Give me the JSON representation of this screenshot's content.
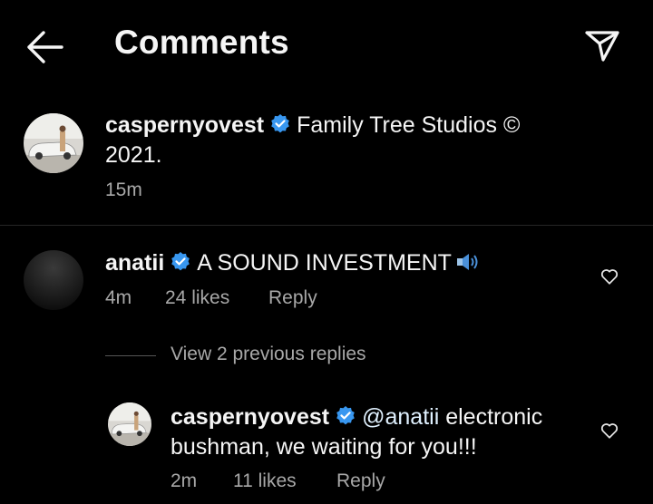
{
  "header": {
    "title": "Comments"
  },
  "caption": {
    "username": "caspernyovest",
    "text": "Family Tree Studios © 2021.",
    "time": "15m"
  },
  "comment": {
    "username": "anatii",
    "text": "A SOUND INVESTMENT",
    "time": "4m",
    "likes": "24 likes",
    "reply_label": "Reply",
    "view_replies": "View 2 previous replies"
  },
  "reply": {
    "username": "caspernyovest",
    "mention": "@anatii",
    "text": " electronic bushman, we waiting for you!!!",
    "time": "2m",
    "likes": "11 likes",
    "reply_label": "Reply"
  },
  "colors": {
    "background": "#000000",
    "text": "#f5f5f5",
    "secondary": "#a8a8a8",
    "verified": "#3897f0"
  },
  "icons": {
    "back": "arrow-left-icon",
    "send": "paper-plane-icon",
    "verified": "verified-badge-icon",
    "heart": "heart-outline-icon",
    "speaker": "speaker-icon"
  }
}
